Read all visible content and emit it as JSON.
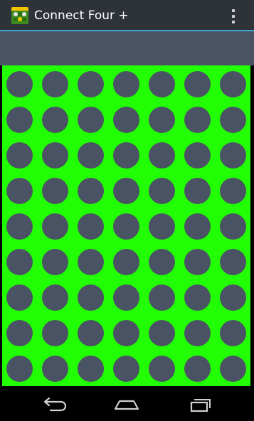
{
  "app": {
    "title": "Connect Four +",
    "icon": "connect-four-app-icon",
    "menu_icon": "overflow-menu-icon"
  },
  "board": {
    "rows": 9,
    "columns": 7,
    "board_color": "#22ff04",
    "empty_slot_color": "#4a5363"
  },
  "colors": {
    "action_bar": "#2e333a",
    "action_bar_divider": "#3aa6d6",
    "toolbar_strip": "#4a5363",
    "nav_bar": "#000000"
  },
  "nav": {
    "back_icon": "back-icon",
    "home_icon": "home-icon",
    "recents_icon": "recent-apps-icon"
  }
}
